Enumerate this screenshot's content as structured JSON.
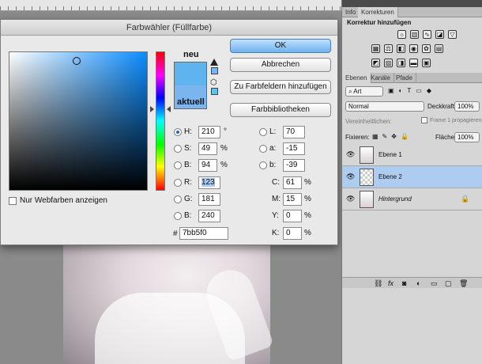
{
  "dialog": {
    "title": "Farbwähler (Füllfarbe)",
    "new_label": "neu",
    "current_label": "aktuell",
    "ok_label": "OK",
    "cancel_label": "Abbrechen",
    "add_swatch_label": "Zu Farbfeldern hinzufügen",
    "libraries_label": "Farbbibliotheken",
    "webcolors_label": "Nur Webfarben anzeigen",
    "hsb": {
      "h_label": "H:",
      "h": "210",
      "h_unit": "°",
      "s_label": "S:",
      "s": "49",
      "s_unit": "%",
      "b_label": "B:",
      "b": "94",
      "b_unit": "%"
    },
    "rgb": {
      "r_label": "R:",
      "r": "123",
      "g_label": "G:",
      "g": "181",
      "b_label": "B:",
      "b": "240"
    },
    "lab": {
      "l_label": "L:",
      "l": "70",
      "a_label": "a:",
      "a": "-15",
      "b_label": "b:",
      "b": "-39"
    },
    "cmyk": {
      "c_label": "C:",
      "c": "61",
      "m_label": "M:",
      "m": "15",
      "y_label": "Y:",
      "y": "0",
      "k_label": "K:",
      "k": "0",
      "unit": "%"
    },
    "hex_label": "#",
    "hex": "7bb5f0",
    "new_color": "#5fb3ef",
    "current_color": "#7bb5f0"
  },
  "panels": {
    "tabs_top": [
      "Info",
      "Korrekturen"
    ],
    "adjust_title": "Korrektur hinzufügen",
    "layers_tabs": [
      "Ebenen",
      "Kanäle",
      "Pfade"
    ],
    "kind_select": "Art",
    "blend_mode": "Normal",
    "opacity_label": "Deckkraft:",
    "opacity": "100%",
    "unify_label": "Vereinheitlichen:",
    "propagate_label": "Frame 1 propagieren",
    "lock_label": "Fixieren:",
    "fill_label": "Fläche:",
    "fill": "100%",
    "layers": [
      {
        "name": "Ebene 1"
      },
      {
        "name": "Ebene 2"
      },
      {
        "name": "Hintergrund"
      }
    ]
  }
}
